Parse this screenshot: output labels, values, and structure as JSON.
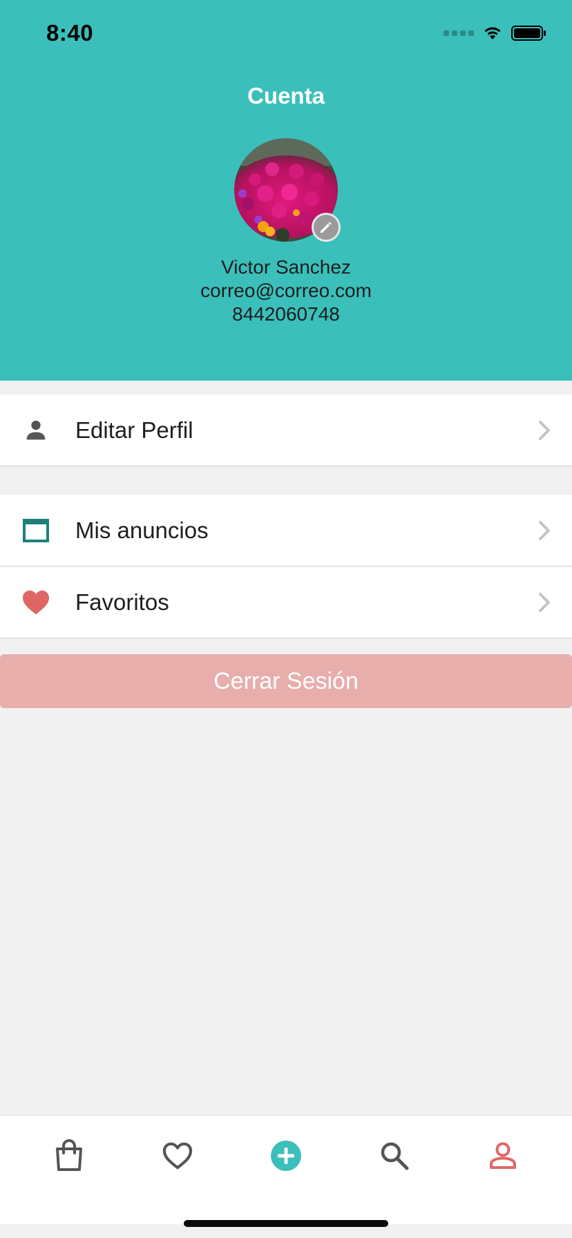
{
  "status_bar": {
    "time": "8:40"
  },
  "header": {
    "title": "Cuenta"
  },
  "profile": {
    "name": "Victor Sanchez",
    "email": "correo@correo.com",
    "phone": "8442060748",
    "avatar_icon": "flower-photo",
    "edit_icon": "pencil-icon"
  },
  "menu": {
    "profile_items": [
      {
        "label": "Editar Perfil",
        "icon": "person-icon"
      }
    ],
    "content_items": [
      {
        "label": "Mis anuncios",
        "icon": "window-icon"
      },
      {
        "label": "Favoritos",
        "icon": "heart-icon"
      }
    ]
  },
  "logout": {
    "label": "Cerrar Sesión"
  },
  "tabbar": {
    "tabs": [
      {
        "icon": "shopping-bag-icon"
      },
      {
        "icon": "heart-outline-icon"
      },
      {
        "icon": "add-circle-icon"
      },
      {
        "icon": "search-icon"
      },
      {
        "icon": "account-icon",
        "active": true
      }
    ]
  },
  "colors": {
    "header_bg": "#3bbfbb",
    "accent_teal": "#3bbfbb",
    "heart_red": "#e06666",
    "logout_bg": "#e8aeac",
    "active_tab": "#e06666",
    "icon_teal_dark": "#1d7f7a"
  }
}
